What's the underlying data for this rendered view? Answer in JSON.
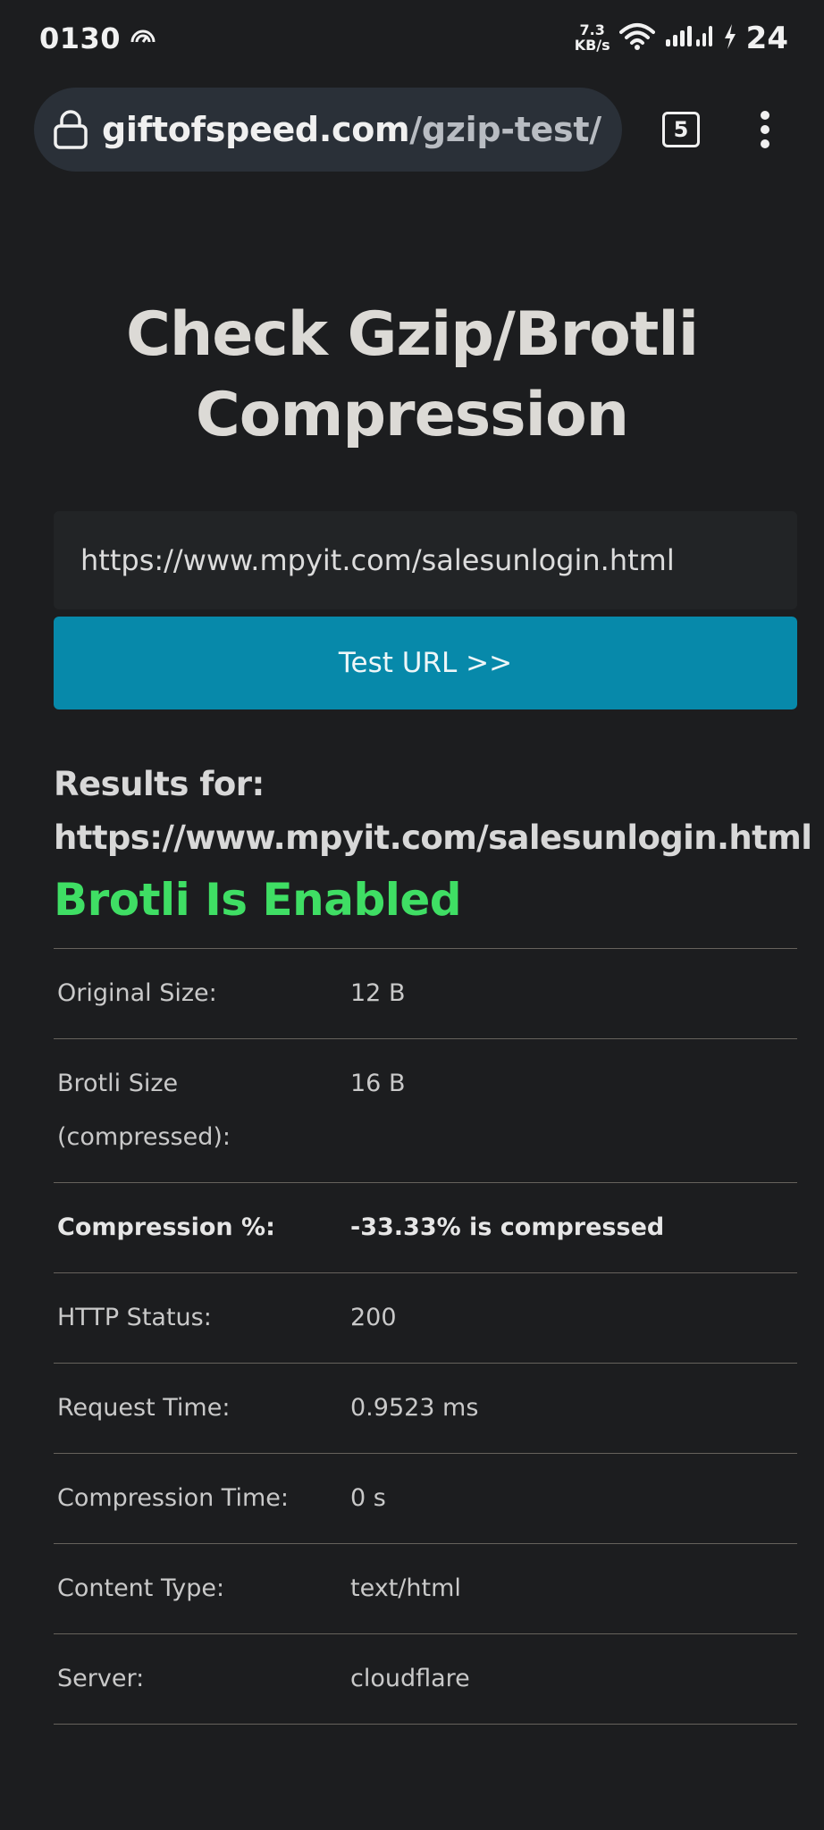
{
  "status_bar": {
    "time": "0130",
    "net_speed_value": "7.3",
    "net_speed_unit": "KB/s",
    "battery": "24"
  },
  "browser": {
    "url_domain": "giftofspeed.com",
    "url_path": "/gzip-test/",
    "tab_count": "5"
  },
  "page": {
    "title_line1": "Check Gzip/Brotli",
    "title_line2": "Compression",
    "url_input_value": "https://www.mpyit.com/salesunlogin.html",
    "test_button_label": "Test URL >>",
    "results_for_label": "Results for:",
    "results_url": "https://www.mpyit.com/salesunlogin.html",
    "status_text": "Brotli Is Enabled",
    "status_color": "#3fde64",
    "accent_color": "#0789aa"
  },
  "results": [
    {
      "label": "Original Size:",
      "value": "12 B"
    },
    {
      "label": "Brotli Size (compressed):",
      "value": "16 B"
    },
    {
      "label": "Compression %:",
      "value": "-33.33% is compressed"
    },
    {
      "label": "HTTP Status:",
      "value": "200"
    },
    {
      "label": "Request Time:",
      "value": "0.9523 ms"
    },
    {
      "label": "Compression Time:",
      "value": "0 s"
    },
    {
      "label": "Content Type:",
      "value": "text/html"
    },
    {
      "label": "Server:",
      "value": "cloudflare"
    }
  ],
  "icons": {
    "data_saver": "data-saver-icon",
    "wifi": "wifi-icon",
    "signal": "signal-icon",
    "charging": "charging-bolt-icon",
    "lock": "lock-icon",
    "tabs": "tabs-icon",
    "menu": "more-vert-icon"
  }
}
